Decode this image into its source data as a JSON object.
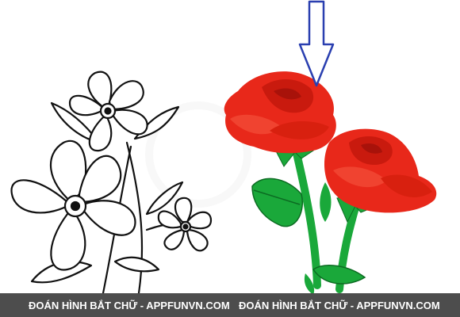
{
  "image": {
    "left_panel": "black-and-white line drawing of five-petal flowers with leaves",
    "right_panel": "two red roses with green stems and leaves",
    "pointer": "blue outlined down arrow pointing at the upper rose"
  },
  "footer": {
    "caption_left": "ĐOÁN HÌNH BẮT CHỮ - APPFUNVN.COM",
    "caption_right": "ĐOÁN HÌNH BẮT CHỮ - APPFUNVN.COM"
  },
  "colors": {
    "rose": "#e8281a",
    "rose_dark": "#b51409",
    "leaf": "#1aa83a",
    "arrow": "#2a3fb0",
    "footer_bg": "#4d4d4d",
    "line_art": "#111111"
  }
}
